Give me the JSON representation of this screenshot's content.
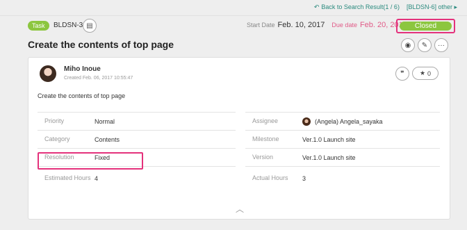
{
  "nav": {
    "back_label": "Back to Search Result(1 / 6)",
    "other_label": "[BLDSN-6] other ▸"
  },
  "issue": {
    "type": "Task",
    "key": "BLDSN-3",
    "title": "Create the contents of top page",
    "start_label": "Start Date",
    "start_date": "Feb. 10, 2017",
    "due_label": "Due date",
    "due_date": "Feb. 20, 2017",
    "status": "Closed",
    "status_color": "#8cc63f"
  },
  "post": {
    "author": "Miho Inoue",
    "created": "Created  Feb. 06, 2017 10:55:47",
    "description": "Create the contents of top page",
    "star_count": "0"
  },
  "properties_left": [
    {
      "label": "Priority",
      "value": "Normal"
    },
    {
      "label": "Category",
      "value": "Contents"
    },
    {
      "label": "Resolution",
      "value": "Fixed"
    },
    {
      "label": "Estimated Hours",
      "value": "4"
    }
  ],
  "properties_right": [
    {
      "label": "Assignee",
      "value": "(Angela) Angela_sayaka"
    },
    {
      "label": "Milestone",
      "value": "Ver.1.0 Launch site"
    },
    {
      "label": "Version",
      "value": "Ver.1.0 Launch site"
    },
    {
      "label": "Actual Hours",
      "value": "3"
    }
  ],
  "highlight_color": "#e4317b",
  "icons": [
    "back-arrow-icon",
    "copy-clipboard-icon",
    "eye-icon",
    "pencil-icon",
    "more-icon",
    "quote-icon",
    "star-icon",
    "chevron-up-icon"
  ]
}
